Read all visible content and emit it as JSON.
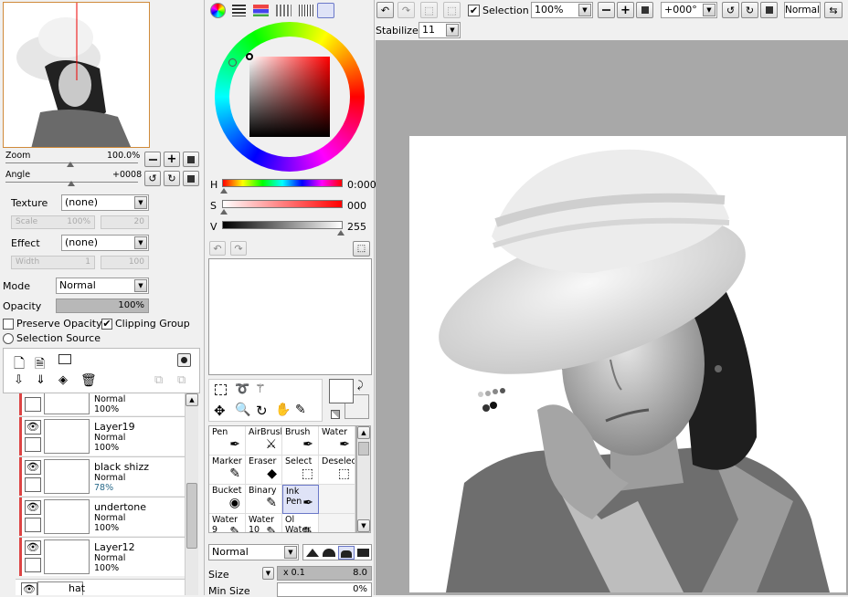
{
  "navigator": {
    "zoom_label": "Zoom",
    "zoom_value": "100.0%",
    "angle_label": "Angle",
    "angle_value": "+0008"
  },
  "texture": {
    "label": "Texture",
    "value": "(none)",
    "scale_label": "Scale",
    "scale_value": "100%",
    "scale_num": "20"
  },
  "effect": {
    "label": "Effect",
    "value": "(none)",
    "width_label": "Width",
    "width_value": "1",
    "width_num": "100"
  },
  "blend": {
    "mode_label": "Mode",
    "mode_value": "Normal",
    "opacity_label": "Opacity",
    "opacity_value": "100%"
  },
  "layer_options": {
    "preserve_opacity": "Preserve Opacity",
    "clipping_group": "Clipping Group",
    "selection_source": "Selection Source"
  },
  "layers": [
    {
      "name": "",
      "mode": "Normal",
      "opacity": "100%"
    },
    {
      "name": "Layer19",
      "mode": "Normal",
      "opacity": "100%"
    },
    {
      "name": "black shizz",
      "mode": "Normal",
      "opacity": "78%"
    },
    {
      "name": "undertone",
      "mode": "Normal",
      "opacity": "100%"
    },
    {
      "name": "Layer12",
      "mode": "Normal",
      "opacity": "100%"
    },
    {
      "name": "hat",
      "mode": "",
      "opacity": ""
    }
  ],
  "color": {
    "h_label": "H",
    "h_value": "0:000",
    "s_label": "S",
    "s_value": "000",
    "v_label": "V",
    "v_value": "255"
  },
  "tools": [
    {
      "name": "Pen",
      "icon": "pen-icon",
      "glyph": "✒"
    },
    {
      "name": "AirBrush",
      "icon": "airbrush-icon",
      "glyph": "✈"
    },
    {
      "name": "Brush",
      "icon": "brush-icon",
      "glyph": "🖌"
    },
    {
      "name": "Water",
      "icon": "water-brush-icon",
      "glyph": "💧"
    },
    {
      "name": "Marker",
      "icon": "marker-icon",
      "glyph": "✎"
    },
    {
      "name": "Eraser",
      "icon": "eraser-icon",
      "glyph": "◆"
    },
    {
      "name": "Select",
      "icon": "select-icon",
      "glyph": "⬚"
    },
    {
      "name": "Deselect",
      "icon": "deselect-icon",
      "glyph": "⬚"
    },
    {
      "name": "Bucket",
      "icon": "bucket-icon",
      "glyph": "◉"
    },
    {
      "name": "Binary",
      "icon": "binary-pen-icon",
      "glyph": "✎"
    },
    {
      "name": "Ink Pen",
      "icon": "ink-pen-icon",
      "glyph": "✒"
    },
    {
      "name": "",
      "icon": "",
      "glyph": ""
    },
    {
      "name": "Water 9",
      "icon": "water9-icon",
      "glyph": "✎"
    },
    {
      "name": "Water 10",
      "icon": "water10-icon",
      "glyph": "✎"
    },
    {
      "name": "Ol Water",
      "icon": "oil-water-icon",
      "glyph": "✎"
    },
    {
      "name": "",
      "icon": "",
      "glyph": ""
    }
  ],
  "brush": {
    "blend_value": "Normal",
    "size_label": "Size",
    "size_mult": "x 0.1",
    "size_value": "8.0",
    "minsize_label": "Min Size",
    "minsize_value": "0%"
  },
  "toolbar": {
    "selection_label": "Selection",
    "zoom_value": "100%",
    "angle_value": "+000°",
    "blend_value": "Normal",
    "stabilizer_label": "Stabilizer",
    "stabilizer_value": "11"
  },
  "colors": {
    "accent": "#d44a55",
    "canvas_bg": "#a8a8a8",
    "panel": "#f0f0f0"
  }
}
